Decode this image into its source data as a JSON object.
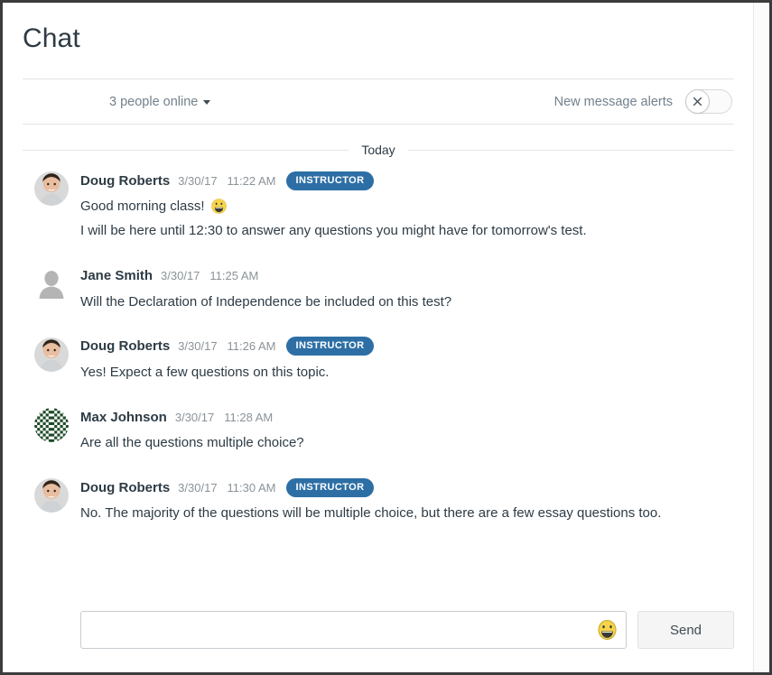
{
  "header": {
    "title": "Chat"
  },
  "toolbar": {
    "online_status": "3 people online",
    "online_caret_icon": "chevron-down-icon",
    "alerts_label": "New message alerts",
    "toggle_state": "off",
    "toggle_icon": "close-x-icon"
  },
  "conversation": {
    "day_divider": "Today",
    "messages": [
      {
        "author": "Doug Roberts",
        "date": "3/30/17",
        "time": "11:22 AM",
        "badge": "INSTRUCTOR",
        "avatar_type": "photo-dark-hair-man",
        "lines": [
          "Good morning class!",
          "I will be here until 12:30 to answer any questions you might have for tomorrow's test."
        ],
        "emoji_on_first_line": "grinning-face-emoji"
      },
      {
        "author": "Jane Smith",
        "date": "3/30/17",
        "time": "11:25 AM",
        "badge": "",
        "avatar_type": "default-silhouette",
        "lines": [
          "Will the Declaration of Independence be included on this test?"
        ],
        "emoji_on_first_line": ""
      },
      {
        "author": "Doug Roberts",
        "date": "3/30/17",
        "time": "11:26 AM",
        "badge": "INSTRUCTOR",
        "avatar_type": "photo-dark-hair-man",
        "lines": [
          "Yes! Expect a few questions on this topic."
        ],
        "emoji_on_first_line": ""
      },
      {
        "author": "Max Johnson",
        "date": "3/30/17",
        "time": "11:28 AM",
        "badge": "",
        "avatar_type": "green-identicon",
        "lines": [
          "Are all the questions multiple choice?"
        ],
        "emoji_on_first_line": ""
      },
      {
        "author": "Doug Roberts",
        "date": "3/30/17",
        "time": "11:30 AM",
        "badge": "INSTRUCTOR",
        "avatar_type": "photo-dark-hair-man",
        "lines": [
          "No. The majority of the questions will be multiple choice, but there are a few essay questions too."
        ],
        "emoji_on_first_line": ""
      }
    ]
  },
  "composer": {
    "input_value": "",
    "input_placeholder": "",
    "emoji_button_icon": "grinning-face-emoji",
    "send_label": "Send"
  },
  "colors": {
    "badge_blue": "#2d6fa5",
    "text_primary": "#2d3b45",
    "text_muted": "#73818c",
    "timestamp": "#8a9399",
    "divider": "#e3e5e7",
    "send_bg": "#f5f5f5",
    "emoji_yellow": "#f5d44c",
    "identicon_green": "#1d4a28"
  }
}
